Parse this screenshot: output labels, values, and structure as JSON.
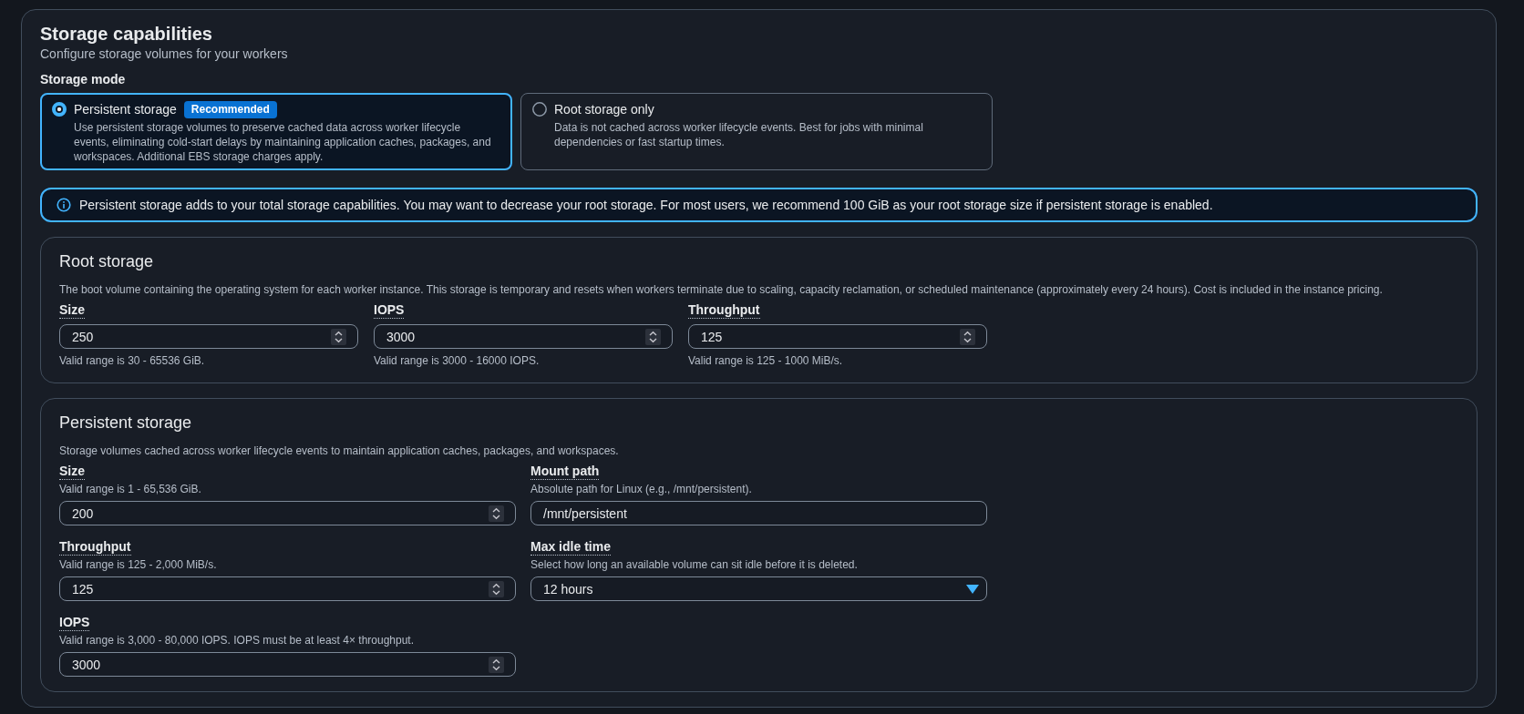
{
  "section": {
    "title": "Storage capabilities",
    "description": "Configure storage volumes for your workers"
  },
  "storage_mode": {
    "label": "Storage mode",
    "options": [
      {
        "label": "Persistent storage",
        "badge": "Recommended",
        "description": "Use persistent storage volumes to preserve cached data across worker lifecycle events, eliminating cold-start delays by maintaining application caches, packages, and workspaces. Additional EBS storage charges apply.",
        "selected": true
      },
      {
        "label": "Root storage only",
        "description": "Data is not cached across worker lifecycle events. Best for jobs with minimal dependencies or fast startup times.",
        "selected": false
      }
    ]
  },
  "info_alert": {
    "text": "Persistent storage adds to your total storage capabilities. You may want to decrease your root storage. For most users, we recommend 100 GiB as your root storage size if persistent storage is enabled."
  },
  "root_storage": {
    "title": "Root storage",
    "description": "The boot volume containing the operating system for each worker instance. This storage is temporary and resets when workers terminate due to scaling, capacity reclamation, or scheduled maintenance (approximately every 24 hours). Cost is included in the instance pricing.",
    "fields": [
      {
        "label": "Size",
        "kind": "number",
        "value": "250",
        "constraint": "Valid range is 30 - 65536 GiB."
      },
      {
        "label": "IOPS",
        "kind": "number",
        "value": "3000",
        "constraint": "Valid range is 3000 - 16000 IOPS."
      },
      {
        "label": "Throughput",
        "kind": "number",
        "value": "125",
        "constraint": "Valid range is 125 - 1000 MiB/s."
      }
    ]
  },
  "persistent_storage": {
    "title": "Persistent storage",
    "description": "Storage volumes cached across worker lifecycle events to maintain application caches, packages, and workspaces.",
    "fields": [
      {
        "label": "Size",
        "description": "Valid range is 1 - 65,536 GiB.",
        "kind": "number",
        "value": "200"
      },
      {
        "label": "Mount path",
        "description": "Absolute path for Linux (e.g., /mnt/persistent).",
        "kind": "text",
        "value": "/mnt/persistent"
      },
      {
        "label": "Throughput",
        "description": "Valid range is 125 - 2,000 MiB/s.",
        "kind": "number",
        "value": "125"
      },
      {
        "label": "Max idle time",
        "description": "Select how long an available volume can sit idle before it is deleted.",
        "kind": "select",
        "value": "12 hours"
      },
      {
        "label": "IOPS",
        "description": "Valid range is 3,000 - 80,000 IOPS. IOPS must be at least 4× throughput.",
        "kind": "number",
        "value": "3000"
      }
    ]
  }
}
